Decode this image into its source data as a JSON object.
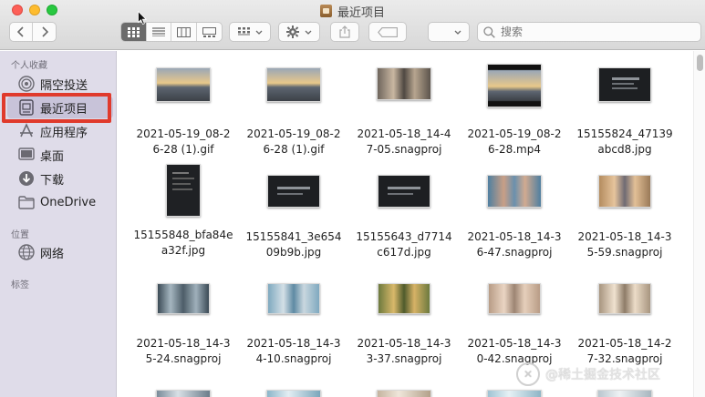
{
  "window": {
    "title": "最近项目"
  },
  "toolbar": {
    "search_placeholder": "搜索"
  },
  "sidebar": {
    "sections": [
      {
        "label": "个人收藏"
      },
      {
        "label": "位置"
      },
      {
        "label": "标签"
      }
    ],
    "items": [
      {
        "label": "隔空投送",
        "icon": "airdrop-icon"
      },
      {
        "label": "最近项目",
        "icon": "recents-icon"
      },
      {
        "label": "应用程序",
        "icon": "applications-icon"
      },
      {
        "label": "桌面",
        "icon": "desktop-icon"
      },
      {
        "label": "下载",
        "icon": "downloads-icon"
      },
      {
        "label": "OneDrive",
        "icon": "folder-icon"
      },
      {
        "label": "网络",
        "icon": "network-icon"
      }
    ]
  },
  "files": [
    {
      "name": "2021-05-19_08-26-28 (1).gif"
    },
    {
      "name": "2021-05-19_08-26-28 (1).gif"
    },
    {
      "name": "2021-05-18_14-47-05.snagproj"
    },
    {
      "name": "2021-05-19_08-26-28.mp4"
    },
    {
      "name": "15155824_47139abcd8.jpg"
    },
    {
      "name": "15155848_bfa84ea32f.jpg"
    },
    {
      "name": "15155841_3e65409b9b.jpg"
    },
    {
      "name": "15155643_d7714c617d.jpg"
    },
    {
      "name": "2021-05-18_14-36-47.snagproj"
    },
    {
      "name": "2021-05-18_14-35-59.snagproj"
    },
    {
      "name": "2021-05-18_14-35-24.snagproj"
    },
    {
      "name": "2021-05-18_14-34-10.snagproj"
    },
    {
      "name": "2021-05-18_14-33-37.snagproj"
    },
    {
      "name": "2021-05-18_14-30-42.snagproj"
    },
    {
      "name": "2021-05-18_14-27-32.snagproj"
    }
  ],
  "watermark": {
    "text": "@稀土掘金技术社区"
  }
}
